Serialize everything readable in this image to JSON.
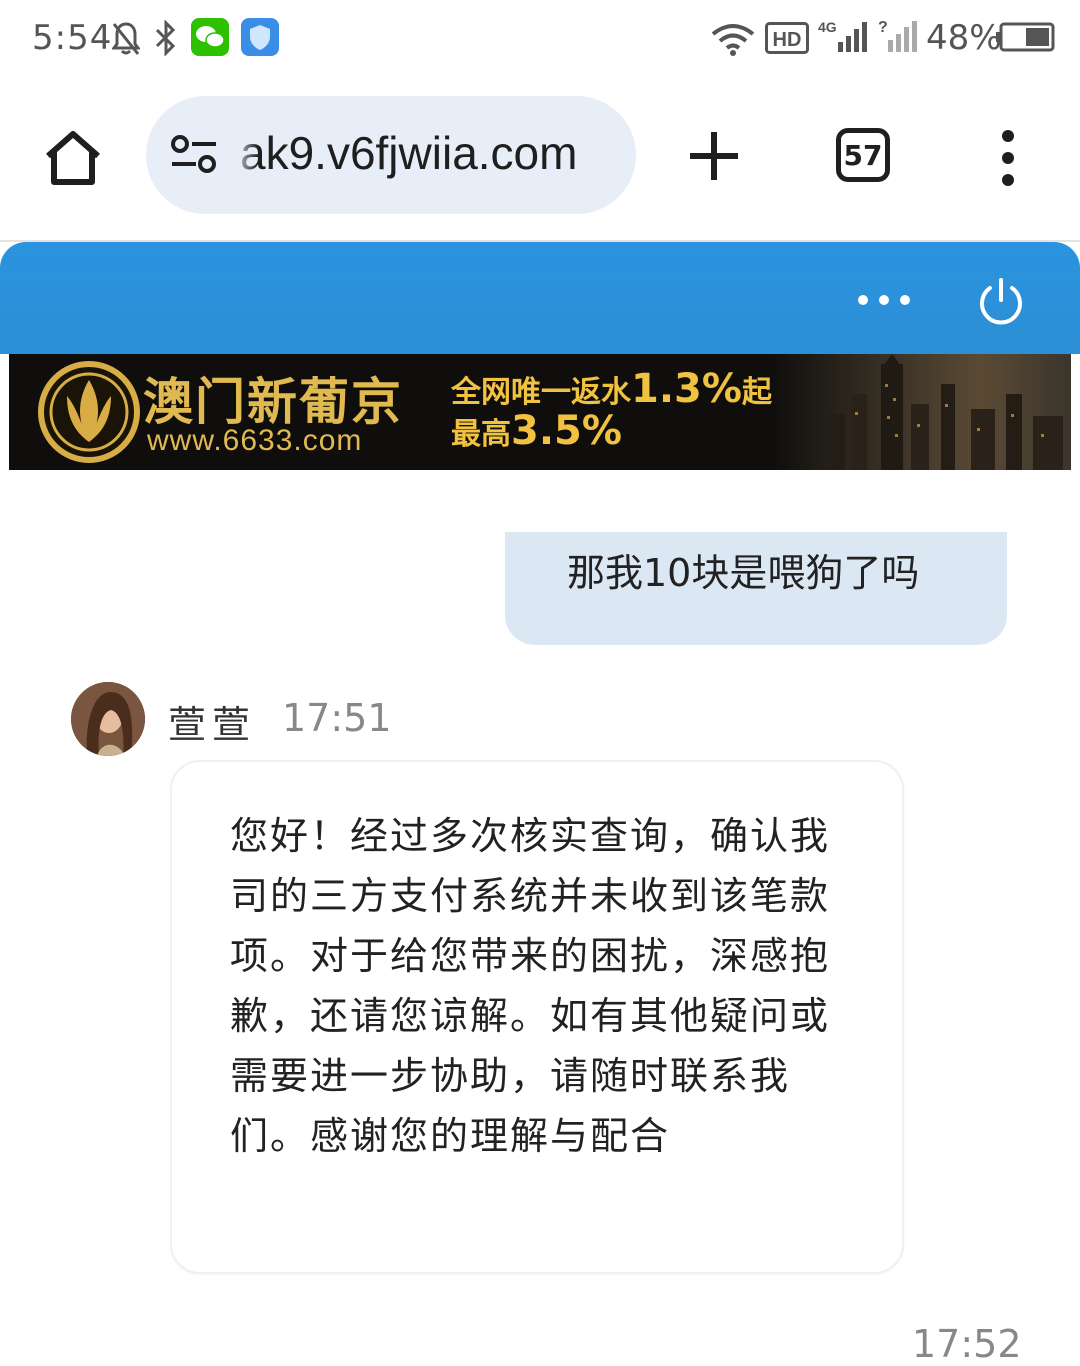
{
  "status_bar": {
    "time": "5:54",
    "battery": "48%",
    "hd_label": "HD",
    "network_label": "4G",
    "icons": [
      "mute-bell-icon",
      "bluetooth-icon",
      "wechat-icon",
      "shield-icon",
      "wifi-icon",
      "signal-icon",
      "signal-unknown-icon",
      "battery-icon"
    ]
  },
  "browser": {
    "url": "ak9.v6fjwiia.com",
    "tab_count": "57",
    "icons": [
      "home-icon",
      "tune-icon",
      "plus-icon",
      "more-vert-icon"
    ]
  },
  "chat_header": {
    "icons": [
      "more-horiz-icon",
      "power-icon"
    ],
    "accent": "#2a93df"
  },
  "banner": {
    "brand": "澳门新葡京",
    "url": "www.6633.com",
    "line1_prefix": "全网唯一返水",
    "line1_value": "1.3%",
    "line1_suffix": "起",
    "line2_prefix": "最高",
    "line2_value": "3.5%",
    "gold": "#e0b950"
  },
  "messages": {
    "outgoing": {
      "text": "那我10块是喂狗了吗"
    },
    "incoming": {
      "sender": "萱萱",
      "time": "17:51",
      "text": "您好！经过多次核实查询，确认我司的三方支付系统并未收到该笔款项。对于给您带来的困扰，深感抱歉，还请您谅解。如有其他疑问或需要进一步协助，请随时联系我们。感谢您的理解与配合"
    },
    "next_time": "17:52"
  }
}
